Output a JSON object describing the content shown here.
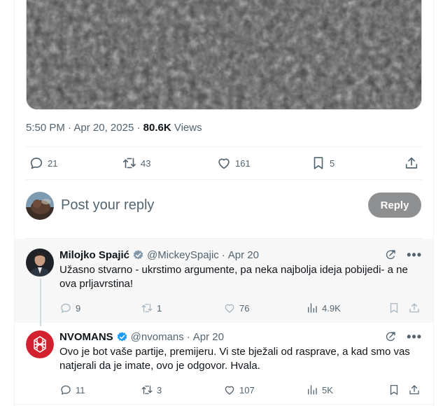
{
  "tweet": {
    "time": "5:50 PM",
    "date": "Apr 20, 2025",
    "views_count": "80.6K",
    "views_label": "Views",
    "stats": {
      "replies": "21",
      "reposts": "43",
      "likes": "161",
      "bookmarks": "5"
    }
  },
  "composer": {
    "placeholder": "Post your reply",
    "reply_button": "Reply"
  },
  "replies": [
    {
      "name": "Milojko Spajić",
      "handle": "@MickeySpajic",
      "date": "Apr 20",
      "text": "Užasno stvarno - ukrstimo argumente, pa neka najbolja ideja pobijedi- a ne ova prljavrstina!",
      "replies": "9",
      "reposts": "1",
      "likes": "76",
      "views": "4.9K",
      "verified_color": "#829aab"
    },
    {
      "name": "NVOMANS",
      "handle": "@nvomans",
      "date": "Apr 20",
      "text": "Ovo je bot vaše partije, premijeru. Vi ste bježali od rasprave, a kad smo vas natjerali da je imate, ovo je odgovor. Hvala.",
      "replies": "11",
      "reposts": "3",
      "likes": "107",
      "views": "5K",
      "verified_color": "#1d9bf0"
    }
  ],
  "sep": "·",
  "more": "•••",
  "colors": {
    "text": "#0f1419",
    "muted": "#536471",
    "border": "#eff3f4",
    "reply_button": "#8d8f91",
    "brand_red": "#d3202f"
  },
  "icons": [
    "reply-icon",
    "repost-icon",
    "like-icon",
    "bookmark-icon",
    "share-icon",
    "views-icon",
    "grok-icon",
    "more-icon",
    "verified-icon"
  ]
}
